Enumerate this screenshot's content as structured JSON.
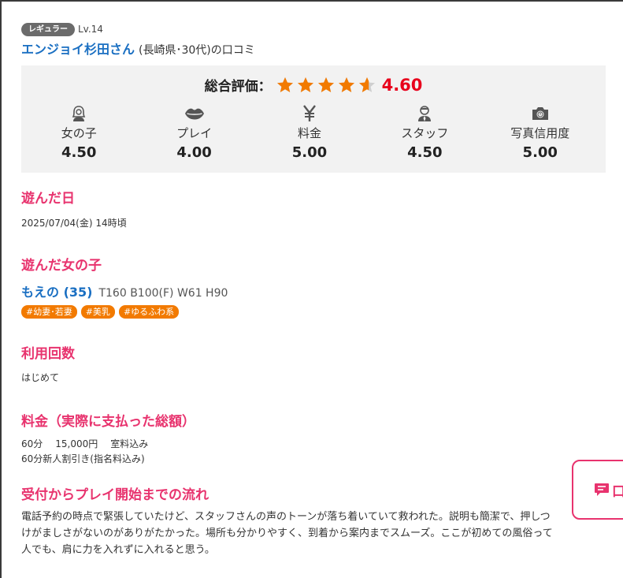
{
  "reviewer": {
    "rank": "レギュラー",
    "level": "Lv.14",
    "name": "エンジョイ杉田さん",
    "info": "(長崎県･30代)の口コミ"
  },
  "rating": {
    "overall_label": "総合評価：",
    "overall_score": "4.60",
    "overall_value": 4.6,
    "star_color": "#f27a00",
    "score_color": "#e8001c",
    "items": [
      {
        "icon": "girl-icon",
        "label": "女の子",
        "score": "4.50"
      },
      {
        "icon": "lips-icon",
        "label": "プレイ",
        "score": "4.00"
      },
      {
        "icon": "yen-icon",
        "label": "料金",
        "score": "5.00"
      },
      {
        "icon": "staff-icon",
        "label": "スタッフ",
        "score": "4.50"
      },
      {
        "icon": "camera-icon",
        "label": "写真信用度",
        "score": "5.00"
      }
    ]
  },
  "visit_date": {
    "title": "遊んだ日",
    "value": "2025/07/04(金) 14時頃"
  },
  "girl": {
    "title": "遊んだ女の子",
    "name": "もえの (35)",
    "stats": "T160 B100(F) W61 H90",
    "tags": [
      "#幼妻･若妻",
      "#美乳",
      "#ゆるふわ系"
    ]
  },
  "usage": {
    "title": "利用回数",
    "value": "はじめて"
  },
  "price": {
    "title": "料金（実際に支払った総額）",
    "duration": "60分",
    "amount": "15,000円",
    "room": "室料込み",
    "note": "60分新人割引き(指名料込み)"
  },
  "flow": {
    "title": "受付からプレイ開始までの流れ",
    "line1": "電話予約の時点で緊張していたけど、スタッフさんの声のトーンが落ち着いていて救われた。説明も簡潔で、押しつ",
    "line2": "けがましさがないのがありがたかった。場所も分かりやすく、到着から案内までスムーズ。ここが初めての風俗って",
    "line3": "人でも、肩に力を入れずに入れると思う。"
  },
  "float_button": {
    "label": "口"
  }
}
